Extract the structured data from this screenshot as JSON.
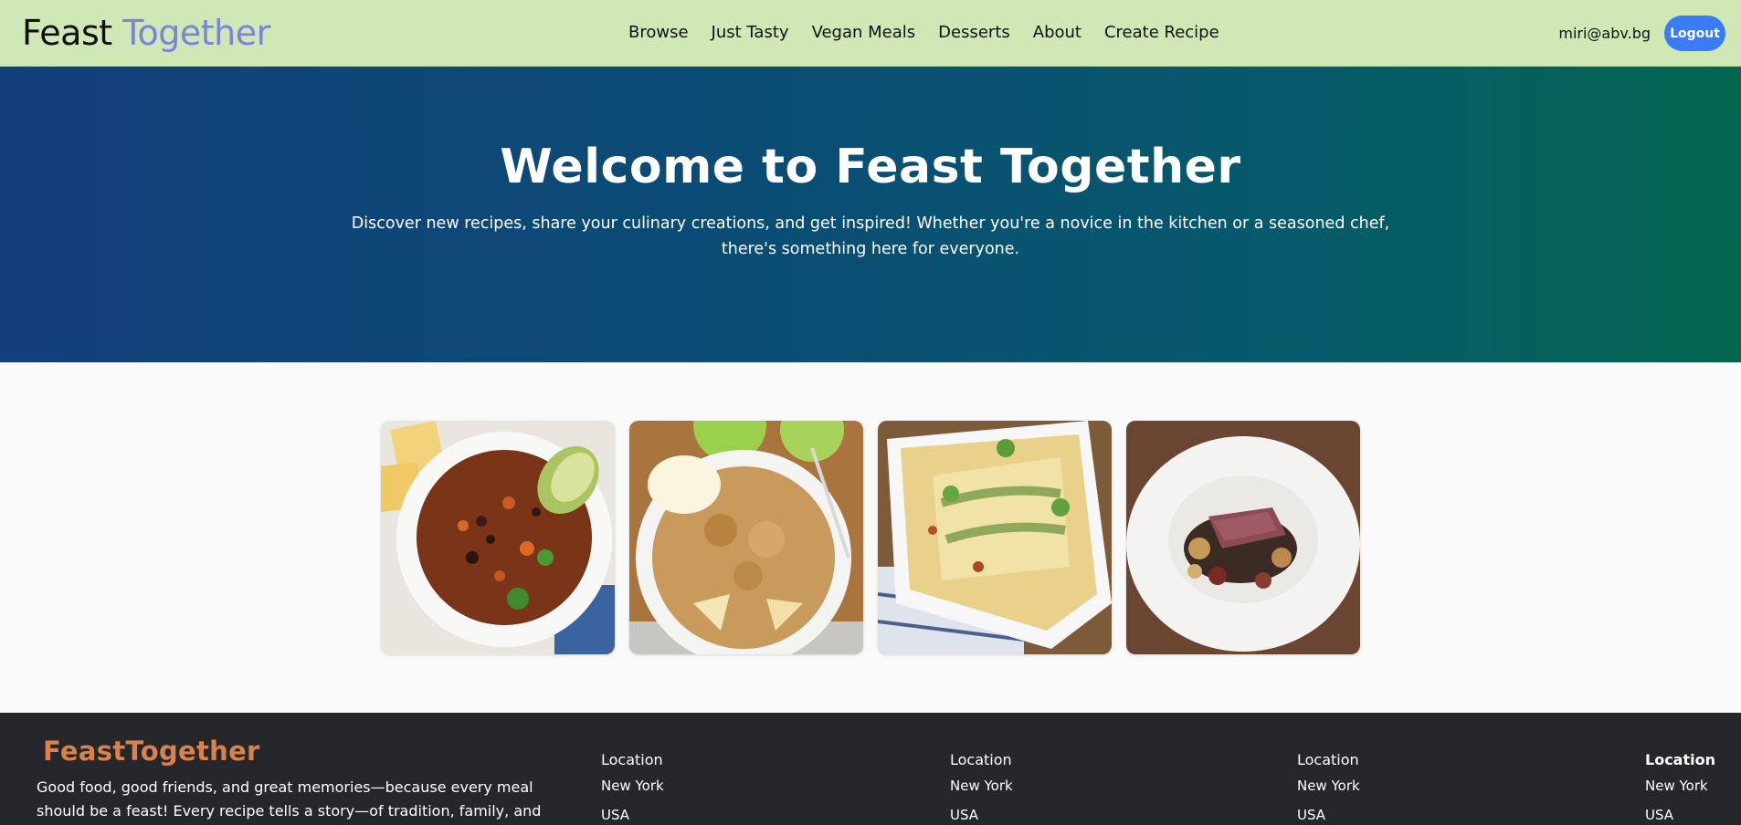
{
  "nav": {
    "brand_part1": "Feast",
    "brand_part2": "Together",
    "links": [
      "Browse",
      "Just Tasty",
      "Vegan Meals",
      "Desserts",
      "About",
      "Create Recipe"
    ],
    "user_email": "miri@abv.bg",
    "logout_label": "Logout"
  },
  "hero": {
    "title": "Welcome to Feast Together",
    "subtitle": "Discover new recipes, share your culinary creations, and get inspired! Whether you're a novice in the kitchen or a seasoned chef, there's something here for everyone."
  },
  "gallery": {
    "items": [
      "bean-chili",
      "apple-crumble",
      "zucchini-lasagna",
      "braised-beef"
    ]
  },
  "footer": {
    "brand": "FeastTogether",
    "description": "Good food, good friends, and great memories—because every meal should be a feast! Every recipe tells a story—of tradition, family, and creativity.",
    "columns": [
      {
        "heading": "Location",
        "city": "New York",
        "country": "USA"
      },
      {
        "heading": "Location",
        "city": "New York",
        "country": "USA"
      },
      {
        "heading": "Location",
        "city": "New York",
        "country": "USA"
      },
      {
        "heading": "Location",
        "city": "New York",
        "country": "USA"
      }
    ]
  },
  "colors": {
    "navbar_bg": "#cfe8b5",
    "brand_accent": "#7b84d8",
    "logout_bg": "#3a7bf6",
    "footer_bg": "#26272b",
    "footer_brand": "#d9824e"
  }
}
